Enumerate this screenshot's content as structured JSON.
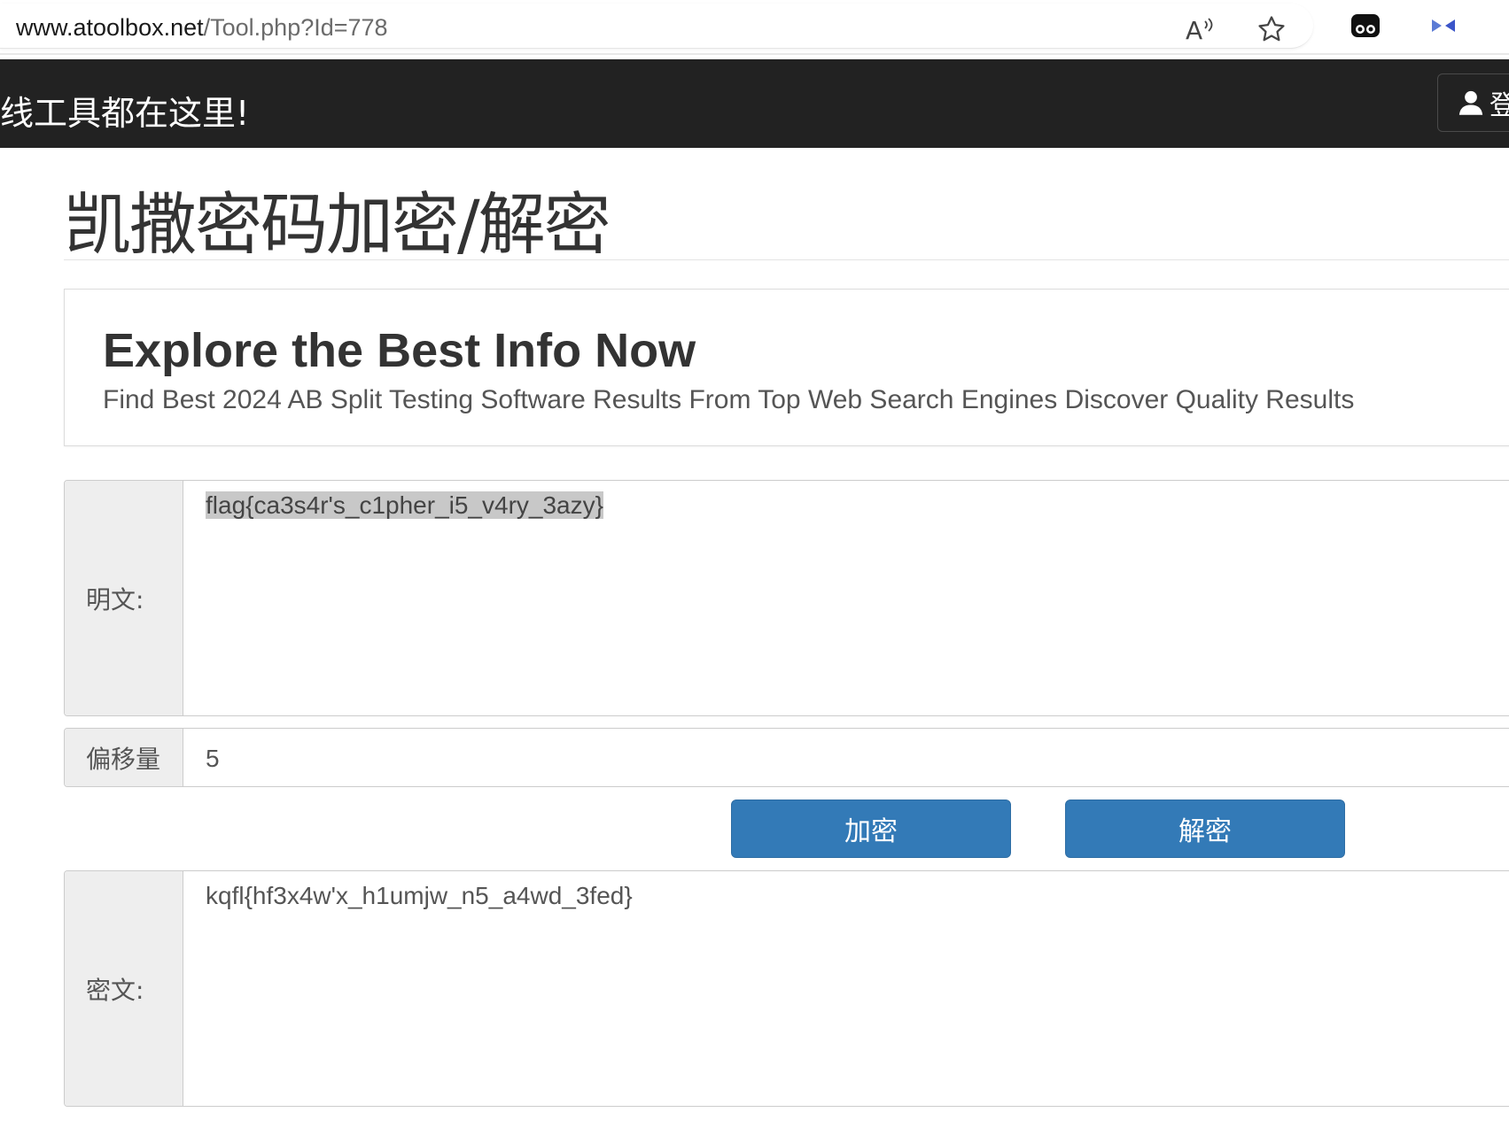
{
  "browser": {
    "url_host": "www.atoolbox.net",
    "url_path": "/Tool.php?Id=778",
    "icons": [
      "read-aloud-icon",
      "favorite-star-icon",
      "extension-icon",
      "bing-copilot-icon"
    ]
  },
  "site": {
    "title": "线工具都在这里!",
    "login_label": "登"
  },
  "page": {
    "title": "凯撒密码加密/解密"
  },
  "ad": {
    "headline": "Explore the Best Info Now",
    "text": "Find Best 2024 AB Split Testing Software Results From Top Web Search Engines Discover Quality Results"
  },
  "form": {
    "plaintext_label": "明文:",
    "plaintext_value": "flag{ca3s4r's_c1pher_i5_v4ry_3azy}",
    "offset_label": "偏移量",
    "offset_value": "5",
    "encrypt_label": "加密",
    "decrypt_label": "解密",
    "ciphertext_label": "密文:",
    "ciphertext_value": "kqfl{hf3x4w'x_h1umjw_n5_a4wd_3fed}"
  },
  "colors": {
    "header_bg": "#222222",
    "button_primary": "#337ab7",
    "addon_bg": "#eeeeee"
  }
}
